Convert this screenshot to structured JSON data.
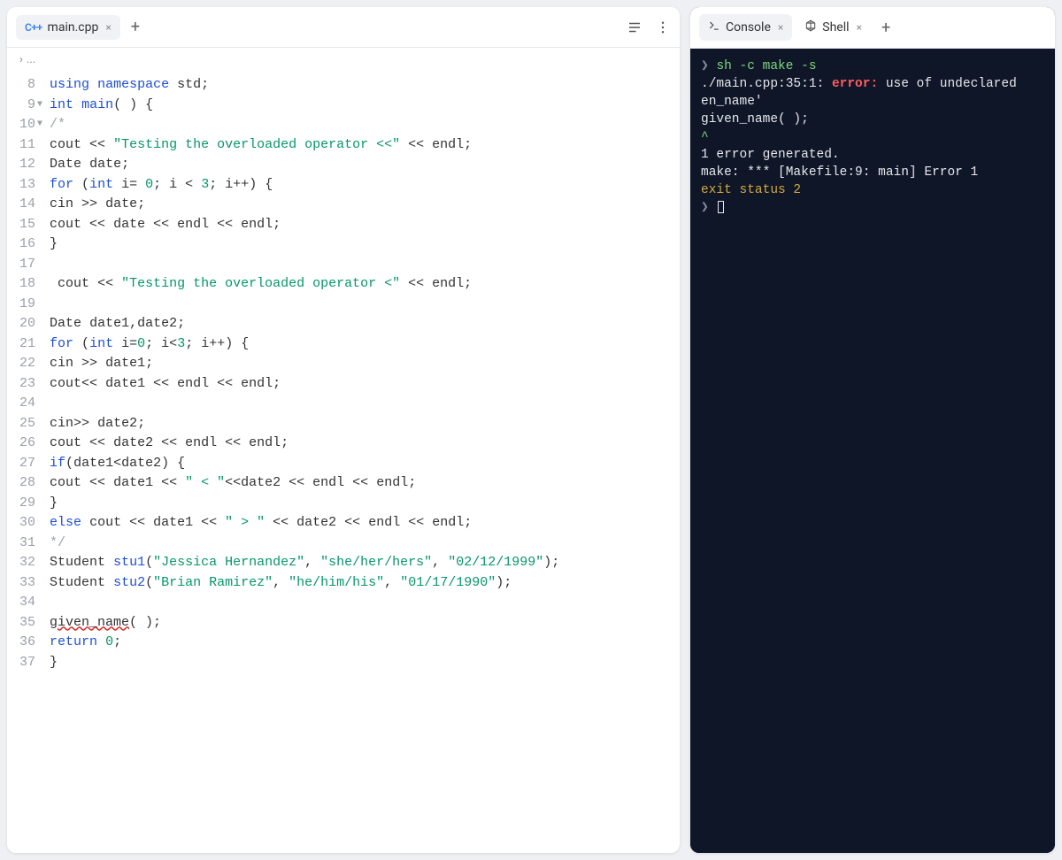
{
  "editor": {
    "tab": {
      "icon": "C++",
      "label": "main.cpp"
    },
    "breadcrumb": "...",
    "lines": [
      {
        "n": 8,
        "fold": "",
        "tokens": [
          [
            "kw",
            "using"
          ],
          [
            "",
            ""
          ],
          [
            "kw",
            "namespace"
          ],
          [
            "",
            ""
          ],
          [
            "id",
            "std"
          ],
          [
            "",
            ";"
          ]
        ]
      },
      {
        "n": 9,
        "fold": "▼",
        "tokens": [
          [
            "ty",
            "int"
          ],
          [
            "",
            ""
          ],
          [
            "fn",
            "main"
          ],
          [
            "",
            "( ) {"
          ]
        ]
      },
      {
        "n": 10,
        "fold": "▼",
        "tokens": [
          [
            "cm",
            "/*"
          ]
        ]
      },
      {
        "n": 11,
        "fold": "",
        "tokens": [
          [
            "id",
            "cout"
          ],
          [
            "",
            " << "
          ],
          [
            "str",
            "\"Testing the overloaded operator <<\""
          ],
          [
            "",
            " << "
          ],
          [
            "id",
            "endl"
          ],
          [
            "",
            ";"
          ]
        ]
      },
      {
        "n": 12,
        "fold": "",
        "tokens": [
          [
            "id",
            "Date"
          ],
          [
            "",
            ""
          ],
          [
            "id",
            "date"
          ],
          [
            "",
            ";"
          ]
        ]
      },
      {
        "n": 13,
        "fold": "",
        "tokens": [
          [
            "kw",
            "for"
          ],
          [
            "",
            " ("
          ],
          [
            "ty",
            "int"
          ],
          [
            "",
            ""
          ],
          [
            "id",
            "i"
          ],
          [
            "",
            "= "
          ],
          [
            "num",
            "0"
          ],
          [
            "",
            "; "
          ],
          [
            "id",
            "i"
          ],
          [
            "",
            " < "
          ],
          [
            "num",
            "3"
          ],
          [
            "",
            "; "
          ],
          [
            "id",
            "i"
          ],
          [
            "",
            "++) {"
          ]
        ]
      },
      {
        "n": 14,
        "fold": "",
        "tokens": [
          [
            "id",
            "cin"
          ],
          [
            "",
            " >> "
          ],
          [
            "id",
            "date"
          ],
          [
            "",
            ";"
          ]
        ]
      },
      {
        "n": 15,
        "fold": "",
        "tokens": [
          [
            "id",
            "cout"
          ],
          [
            "",
            " << "
          ],
          [
            "id",
            "date"
          ],
          [
            "",
            " << "
          ],
          [
            "id",
            "endl"
          ],
          [
            "",
            " << "
          ],
          [
            "id",
            "endl"
          ],
          [
            "",
            ";"
          ]
        ]
      },
      {
        "n": 16,
        "fold": "",
        "tokens": [
          [
            "",
            "}"
          ]
        ]
      },
      {
        "n": 17,
        "fold": "",
        "tokens": []
      },
      {
        "n": 18,
        "fold": "",
        "tokens": [
          [
            "",
            ""
          ],
          [
            "id",
            "cout"
          ],
          [
            "",
            " << "
          ],
          [
            "str",
            "\"Testing the overloaded operator <\""
          ],
          [
            "",
            " << "
          ],
          [
            "id",
            "endl"
          ],
          [
            "",
            ";"
          ]
        ]
      },
      {
        "n": 19,
        "fold": "",
        "tokens": []
      },
      {
        "n": 20,
        "fold": "",
        "tokens": [
          [
            "id",
            "Date"
          ],
          [
            "",
            ""
          ],
          [
            "id",
            "date1"
          ],
          [
            "",
            ","
          ],
          [
            "id",
            "date2"
          ],
          [
            "",
            ";"
          ]
        ]
      },
      {
        "n": 21,
        "fold": "",
        "tokens": [
          [
            "kw",
            "for"
          ],
          [
            "",
            " ("
          ],
          [
            "ty",
            "int"
          ],
          [
            "",
            ""
          ],
          [
            "id",
            "i"
          ],
          [
            "",
            "="
          ],
          [
            "num",
            "0"
          ],
          [
            "",
            "; "
          ],
          [
            "id",
            "i"
          ],
          [
            "",
            "<"
          ],
          [
            "num",
            "3"
          ],
          [
            "",
            "; "
          ],
          [
            "id",
            "i"
          ],
          [
            "",
            "++) {"
          ]
        ]
      },
      {
        "n": 22,
        "fold": "",
        "tokens": [
          [
            "id",
            "cin"
          ],
          [
            "",
            " >> "
          ],
          [
            "id",
            "date1"
          ],
          [
            "",
            ";"
          ]
        ]
      },
      {
        "n": 23,
        "fold": "",
        "tokens": [
          [
            "id",
            "cout"
          ],
          [
            "",
            "<< "
          ],
          [
            "id",
            "date1"
          ],
          [
            "",
            " << "
          ],
          [
            "id",
            "endl"
          ],
          [
            "",
            " << "
          ],
          [
            "id",
            "endl"
          ],
          [
            "",
            ";"
          ]
        ]
      },
      {
        "n": 24,
        "fold": "",
        "tokens": []
      },
      {
        "n": 25,
        "fold": "",
        "tokens": [
          [
            "id",
            "cin"
          ],
          [
            "",
            ">> "
          ],
          [
            "id",
            "date2"
          ],
          [
            "",
            ";"
          ]
        ]
      },
      {
        "n": 26,
        "fold": "",
        "tokens": [
          [
            "id",
            "cout"
          ],
          [
            "",
            " << "
          ],
          [
            "id",
            "date2"
          ],
          [
            "",
            " << "
          ],
          [
            "id",
            "endl"
          ],
          [
            "",
            " << "
          ],
          [
            "id",
            "endl"
          ],
          [
            "",
            ";"
          ]
        ]
      },
      {
        "n": 27,
        "fold": "",
        "tokens": [
          [
            "kw",
            "if"
          ],
          [
            "",
            "("
          ],
          [
            "id",
            "date1"
          ],
          [
            "",
            "<"
          ],
          [
            "id",
            "date2"
          ],
          [
            "",
            ") {"
          ]
        ]
      },
      {
        "n": 28,
        "fold": "",
        "tokens": [
          [
            "id",
            "cout"
          ],
          [
            "",
            " << "
          ],
          [
            "id",
            "date1"
          ],
          [
            "",
            " << "
          ],
          [
            "str",
            "\" < \""
          ],
          [
            "",
            "<<"
          ],
          [
            "id",
            "date2"
          ],
          [
            "",
            " << "
          ],
          [
            "id",
            "endl"
          ],
          [
            "",
            " << "
          ],
          [
            "id",
            "endl"
          ],
          [
            "",
            ";"
          ]
        ]
      },
      {
        "n": 29,
        "fold": "",
        "tokens": [
          [
            "",
            "}"
          ]
        ]
      },
      {
        "n": 30,
        "fold": "",
        "tokens": [
          [
            "kw",
            "else"
          ],
          [
            "",
            ""
          ],
          [
            "id",
            "cout"
          ],
          [
            "",
            " << "
          ],
          [
            "id",
            "date1"
          ],
          [
            "",
            " << "
          ],
          [
            "str",
            "\" > \""
          ],
          [
            "",
            " << "
          ],
          [
            "id",
            "date2"
          ],
          [
            "",
            " << "
          ],
          [
            "id",
            "endl"
          ],
          [
            "",
            " << "
          ],
          [
            "id",
            "endl"
          ],
          [
            "",
            ";"
          ]
        ]
      },
      {
        "n": 31,
        "fold": "",
        "tokens": [
          [
            "cm",
            "*/"
          ]
        ]
      },
      {
        "n": 32,
        "fold": "",
        "tokens": [
          [
            "id",
            "Student"
          ],
          [
            "",
            ""
          ],
          [
            "fn",
            "stu1"
          ],
          [
            "",
            "("
          ],
          [
            "str",
            "\"Jessica Hernandez\""
          ],
          [
            "",
            ", "
          ],
          [
            "str",
            "\"she/her/hers\""
          ],
          [
            "",
            ", "
          ],
          [
            "str",
            "\"02/12/1999\""
          ],
          [
            "",
            ");"
          ]
        ]
      },
      {
        "n": 33,
        "fold": "",
        "tokens": [
          [
            "id",
            "Student"
          ],
          [
            "",
            ""
          ],
          [
            "fn",
            "stu2"
          ],
          [
            "",
            "("
          ],
          [
            "str",
            "\"Brian Ramirez\""
          ],
          [
            "",
            ", "
          ],
          [
            "str",
            "\"he/him/his\""
          ],
          [
            "",
            ", "
          ],
          [
            "str",
            "\"01/17/1990\""
          ],
          [
            "",
            ");"
          ]
        ]
      },
      {
        "n": 34,
        "fold": "",
        "tokens": []
      },
      {
        "n": 35,
        "fold": "",
        "tokens": [
          [
            "wavy",
            "given_name"
          ],
          [
            "",
            "( );"
          ]
        ]
      },
      {
        "n": 36,
        "fold": "",
        "tokens": [
          [
            "kw",
            "return"
          ],
          [
            "",
            ""
          ],
          [
            "num",
            "0"
          ],
          [
            "",
            ";"
          ]
        ]
      },
      {
        "n": 37,
        "fold": "",
        "tokens": [
          [
            "",
            "}"
          ]
        ]
      }
    ]
  },
  "console": {
    "tabs": {
      "console": "Console",
      "shell": "Shell"
    },
    "output": [
      {
        "segs": [
          [
            "prompt-ch",
            "❯ "
          ],
          [
            "c-green",
            "sh -c make -s"
          ]
        ]
      },
      {
        "segs": [
          [
            "c-white",
            "./main.cpp:35:1: "
          ],
          [
            "c-red",
            "error:"
          ],
          [
            "c-white",
            " use of undeclared"
          ]
        ]
      },
      {
        "segs": [
          [
            "c-white",
            "en_name'"
          ]
        ]
      },
      {
        "segs": [
          [
            "c-white",
            "given_name( );"
          ]
        ]
      },
      {
        "segs": [
          [
            "caret",
            "^"
          ]
        ]
      },
      {
        "segs": [
          [
            "c-white",
            "1 error generated."
          ]
        ]
      },
      {
        "segs": [
          [
            "c-white",
            "make: *** [Makefile:9: main] Error 1"
          ]
        ]
      },
      {
        "segs": [
          [
            "c-ylw",
            "exit status 2"
          ]
        ]
      },
      {
        "segs": [
          [
            "prompt-ch",
            "❯ "
          ],
          [
            "cursor",
            ""
          ]
        ]
      }
    ]
  }
}
